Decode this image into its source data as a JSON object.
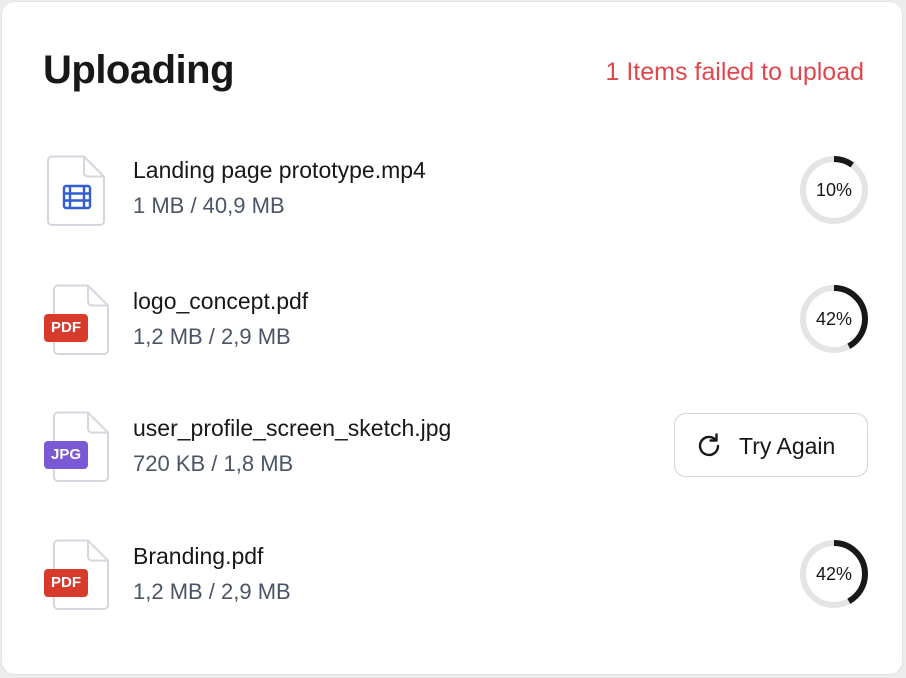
{
  "header": {
    "title": "Uploading",
    "status_text": "1 Items failed to upload",
    "status_color": "#e0474c"
  },
  "files": [
    {
      "name": "Landing page prototype.mp4",
      "size": "1 MB / 40,9 MB",
      "icon": "video-file-icon",
      "badge": "",
      "progress_percent": 10,
      "progress_label": "10%"
    },
    {
      "name": "logo_concept.pdf",
      "size": "1,2 MB / 2,9 MB",
      "icon": "pdf-file-icon",
      "badge": "PDF",
      "progress_percent": 42,
      "progress_label": "42%"
    },
    {
      "name": "user_profile_screen_sketch.jpg",
      "size": "720 KB / 1,8 MB",
      "icon": "jpg-file-icon",
      "badge": "JPG",
      "failed": true,
      "action_label": "Try Again",
      "action_icon": "refresh-icon"
    },
    {
      "name": "Branding.pdf",
      "size": "1,2 MB / 2,9 MB",
      "icon": "pdf-file-icon",
      "badge": "PDF",
      "progress_percent": 42,
      "progress_label": "42%"
    }
  ],
  "colors": {
    "progress_track": "#e4e4e7",
    "progress_fill": "#18181b",
    "pdf_badge": "#d63b2c",
    "jpg_badge": "#7a5ad4",
    "video_icon": "#2f5fd0"
  }
}
